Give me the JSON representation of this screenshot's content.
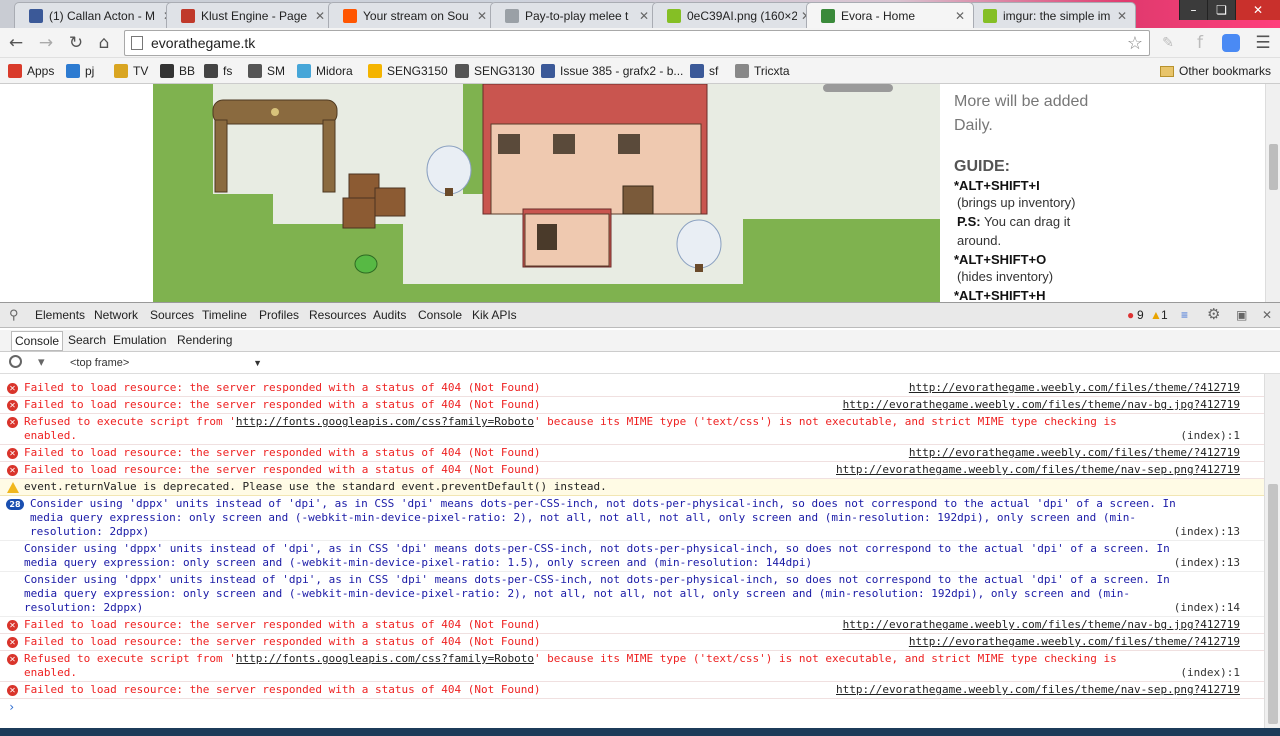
{
  "tabs": [
    {
      "title": "(1) Callan Acton - M",
      "color": "#3b5998"
    },
    {
      "title": "Klust Engine - Page",
      "color": "#c0392b"
    },
    {
      "title": "Your stream on Sou",
      "color": "#ff5500"
    },
    {
      "title": "Pay-to-play melee t",
      "color": "#9aa0a6"
    },
    {
      "title": "0eC39AI.png (160×2",
      "color": "#85bf25"
    },
    {
      "title": "Evora - Home",
      "color": "#3a8a3a"
    },
    {
      "title": "imgur: the simple im",
      "color": "#85bf25"
    }
  ],
  "toolbar": {
    "url": "evorathegame.tk"
  },
  "bookmarks": [
    {
      "label": "Apps",
      "color": "#d93b2b"
    },
    {
      "label": "pj",
      "color": "#2d7bd1"
    },
    {
      "label": "TV",
      "color": "#d9a521"
    },
    {
      "label": "BB",
      "color": "#333333"
    },
    {
      "label": "fs",
      "color": "#444444"
    },
    {
      "label": "SM",
      "color": "#555555"
    },
    {
      "label": "Midora",
      "color": "#46a6d8"
    },
    {
      "label": "SENG3150",
      "color": "#f4b400"
    },
    {
      "label": "SENG3130",
      "color": "#555555"
    },
    {
      "label": "Issue 385 - grafx2 - b...",
      "color": "#3b5998"
    },
    {
      "label": "sf",
      "color": "#3b5998"
    },
    {
      "label": "Tricxta",
      "color": "#888888"
    }
  ],
  "other_bookmarks": "Other bookmarks",
  "page": {
    "more_text": "More will be added Daily.",
    "guide_title": "GUIDE:",
    "guide": [
      {
        "key": "*ALT+SHIFT+I",
        "note": "(brings up inventory)"
      },
      {
        "key": "P.S:",
        "note": "You can drag it around."
      },
      {
        "key": "*ALT+SHIFT+O",
        "note": "(hides inventory)"
      },
      {
        "key": "*ALT+SHIFT+H",
        "note": ""
      }
    ]
  },
  "devtools": {
    "tabs": [
      "Elements",
      "Network",
      "Sources",
      "Timeline",
      "Profiles",
      "Resources",
      "Audits",
      "Console",
      "Kik APIs"
    ],
    "error_count": "9",
    "warning_count": "1",
    "drawer_tabs": [
      "Console",
      "Search",
      "Emulation",
      "Rendering"
    ],
    "frame": "<top frame>"
  },
  "console_rows": [
    {
      "type": "err",
      "msg": "Failed to load resource: the server responded with a status of 404 (Not Found)",
      "src": "http://evorathegame.weebly.com/files/theme/?412719"
    },
    {
      "type": "err",
      "msg": "Failed to load resource: the server responded with a status of 404 (Not Found)",
      "src": "http://evorathegame.weebly.com/files/theme/nav-bg.jpg?412719"
    },
    {
      "type": "err2",
      "msg_pre": "Refused to execute script from '",
      "msg_link": "http://fonts.googleapis.com/css?family=Roboto",
      "msg_post": "' because its MIME type ('text/css') is not executable, and strict MIME type checking is\nenabled.",
      "src": "(index):1"
    },
    {
      "type": "err",
      "msg": "Failed to load resource: the server responded with a status of 404 (Not Found)",
      "src": "http://evorathegame.weebly.com/files/theme/?412719"
    },
    {
      "type": "err",
      "msg": "Failed to load resource: the server responded with a status of 404 (Not Found)",
      "src": "http://evorathegame.weebly.com/files/theme/nav-sep.png?412719"
    },
    {
      "type": "warn",
      "msg": "event.returnValue is deprecated. Please use the standard event.preventDefault() instead.",
      "src": ""
    },
    {
      "type": "info",
      "badge": "28",
      "msg": "Consider using 'dppx' units instead of 'dpi', as in CSS 'dpi' means dots-per-CSS-inch, not dots-per-physical-inch, so does not correspond to the actual 'dpi' of a screen. In\nmedia query expression: only screen and (-webkit-min-device-pixel-ratio: 2), not all, not all, not all, only screen and (min-resolution: 192dpi), only screen and (min-\nresolution: 2dppx)",
      "src": "(index):13"
    },
    {
      "type": "info",
      "msg": "Consider using 'dppx' units instead of 'dpi', as in CSS 'dpi' means dots-per-CSS-inch, not dots-per-physical-inch, so does not correspond to the actual 'dpi' of a screen. In\nmedia query expression: only screen and (-webkit-min-device-pixel-ratio: 1.5), only screen and (min-resolution: 144dpi)",
      "src": "(index):13"
    },
    {
      "type": "info",
      "msg": "Consider using 'dppx' units instead of 'dpi', as in CSS 'dpi' means dots-per-CSS-inch, not dots-per-physical-inch, so does not correspond to the actual 'dpi' of a screen. In\nmedia query expression: only screen and (-webkit-min-device-pixel-ratio: 2), not all, not all, not all, only screen and (min-resolution: 192dpi), only screen and (min-\nresolution: 2dppx)",
      "src": "(index):14"
    },
    {
      "type": "err",
      "msg": "Failed to load resource: the server responded with a status of 404 (Not Found)",
      "src": "http://evorathegame.weebly.com/files/theme/nav-bg.jpg?412719"
    },
    {
      "type": "err",
      "msg": "Failed to load resource: the server responded with a status of 404 (Not Found)",
      "src": "http://evorathegame.weebly.com/files/theme/?412719"
    },
    {
      "type": "err2",
      "msg_pre": "Refused to execute script from '",
      "msg_link": "http://fonts.googleapis.com/css?family=Roboto",
      "msg_post": "' because its MIME type ('text/css') is not executable, and strict MIME type checking is\nenabled.",
      "src": "(index):1"
    },
    {
      "type": "err",
      "msg": "Failed to load resource: the server responded with a status of 404 (Not Found)",
      "src": "http://evorathegame.weebly.com/files/theme/nav-sep.png?412719"
    }
  ],
  "prompt": "›"
}
